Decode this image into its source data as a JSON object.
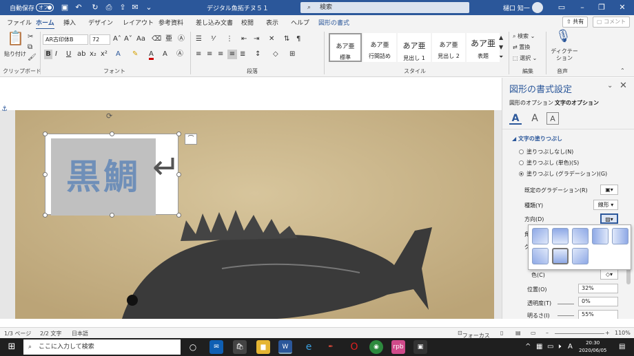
{
  "titlebar": {
    "autosave": "自動保存",
    "autosave_state": "オフ",
    "doc_title": "デジタル魚拓チヌ５１",
    "search": "検索",
    "user": "樋口 知一"
  },
  "tabs": {
    "items": [
      "ファイル",
      "ホーム",
      "挿入",
      "デザイン",
      "レイアウト",
      "参考資料",
      "差し込み文書",
      "校閲",
      "表示",
      "ヘルプ",
      "図形の書式"
    ],
    "share": "共有",
    "comment": "コメント"
  },
  "ribbon": {
    "clipboard": {
      "paste": "貼り付け",
      "group": "クリップボード"
    },
    "font": {
      "name": "AR古印体B",
      "size": "72",
      "group": "フォント",
      "bold": "B",
      "italic": "I",
      "underline": "U",
      "aa": "Aa",
      "color": "A"
    },
    "paragraph": {
      "group": "段落"
    },
    "styles": {
      "group": "スタイル",
      "items": [
        {
          "preview": "あア亜",
          "label": "標準"
        },
        {
          "preview": "あア亜",
          "label": "行間詰め"
        },
        {
          "preview": "あア亜",
          "label": "見出し 1"
        },
        {
          "preview": "あア亜",
          "label": "見出し 2"
        },
        {
          "preview": "あア亜",
          "label": "表題"
        }
      ]
    },
    "editing": {
      "group": "編集",
      "find": "検索",
      "replace": "置換",
      "select": "選択"
    },
    "voice": {
      "group": "音声",
      "dictate": "ディクテーション"
    }
  },
  "document": {
    "text": "黒鯛"
  },
  "pane": {
    "title": "図形の書式設定",
    "tab_shape": "図形のオプション",
    "tab_text": "文字のオプション",
    "section": "文字の塗りつぶし",
    "fill_none": "塗りつぶしなし(N)",
    "fill_solid": "塗りつぶし (単色)(S)",
    "fill_gradient": "塗りつぶし (グラデーション)(G)",
    "preset_label": "既定のグラデーション(R)",
    "type_label": "種類(Y)",
    "type_value": "線形",
    "direction_label": "方向(D)",
    "angle_label": "角",
    "stop_label": "グラ",
    "color_label": "色(C)",
    "position_label": "位置(O)",
    "position_value": "32%",
    "transparency_label": "透明度(T)",
    "transparency_value": "0%",
    "brightness_label": "明るさ(I)",
    "brightness_value": "55%"
  },
  "statusbar": {
    "page": "1/3 ページ",
    "words": "2/2 文字",
    "lang": "日本語",
    "focus": "フォーカス",
    "zoom": "110%"
  },
  "taskbar": {
    "search": "ここに入力して検索",
    "time": "20:30",
    "date": "2020/06/05"
  }
}
